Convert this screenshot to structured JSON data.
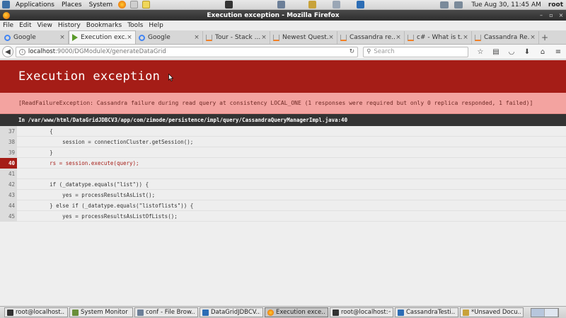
{
  "top_panel": {
    "menus": [
      "Applications",
      "Places",
      "System"
    ],
    "clock": "Tue Aug 30, 11:45 AM",
    "user": "root"
  },
  "window": {
    "title": "Execution exception - Mozilla Firefox",
    "controls": [
      "–",
      "▫",
      "×"
    ]
  },
  "menubar": [
    "File",
    "Edit",
    "View",
    "History",
    "Bookmarks",
    "Tools",
    "Help"
  ],
  "tabs": [
    {
      "label": "Google",
      "icon": "google-icon",
      "color": "#4285f4",
      "active": false
    },
    {
      "label": "Execution exc...",
      "icon": "play-icon",
      "color": "#5a9a2a",
      "active": true
    },
    {
      "label": "Google",
      "icon": "google-icon",
      "color": "#4285f4",
      "active": false
    },
    {
      "label": "Tour - Stack ...",
      "icon": "stackoverflow-icon",
      "color": "#f48024",
      "active": false
    },
    {
      "label": "Newest Quest...",
      "icon": "stackoverflow-icon",
      "color": "#f48024",
      "active": false
    },
    {
      "label": "Cassandra re...",
      "icon": "stackoverflow-icon",
      "color": "#f48024",
      "active": false
    },
    {
      "label": "c# - What is t...",
      "icon": "stackoverflow-icon",
      "color": "#f48024",
      "active": false
    },
    {
      "label": "Cassandra Re...",
      "icon": "stackoverflow-icon",
      "color": "#f48024",
      "active": false
    }
  ],
  "nav": {
    "url_host": "localhost",
    "url_path": ":9000/DGModuleX/generateDataGrid",
    "search_placeholder": "Search"
  },
  "page": {
    "title": "Execution exception",
    "message": "[ReadFailureException: Cassandra failure during read query at consistency LOCAL_ONE (1 responses were required but only 0 replica responded, 1 failed)]",
    "file": "In /var/www/html/DataGridJDBCV3/app/com/zimode/persistence/impl/query/CassandraQueryManagerImpl.java:40",
    "code": [
      {
        "line": "37",
        "text": "        {",
        "highlight": false
      },
      {
        "line": "38",
        "text": "            session = connectionCluster.getSession();",
        "highlight": false
      },
      {
        "line": "39",
        "text": "        }",
        "highlight": false
      },
      {
        "line": "40",
        "text": "        rs = session.execute(query);",
        "highlight": true
      },
      {
        "line": "41",
        "text": "",
        "highlight": false
      },
      {
        "line": "42",
        "text": "        if (_datatype.equals(\"list\")) {",
        "highlight": false
      },
      {
        "line": "43",
        "text": "            yes = processResultsAsList();",
        "highlight": false
      },
      {
        "line": "44",
        "text": "        } else if (_datatype.equals(\"listoflists\")) {",
        "highlight": false
      },
      {
        "line": "45",
        "text": "            yes = processResultsAsListOfLists();",
        "highlight": false
      }
    ]
  },
  "taskbar": [
    {
      "label": "root@localhost...",
      "icon": "terminal-icon",
      "color": "#333333",
      "active": false
    },
    {
      "label": "System Monitor",
      "icon": "monitor-icon",
      "color": "#6a8f3a",
      "active": false
    },
    {
      "label": "conf - File Brow...",
      "icon": "folder-icon",
      "color": "#6c7f98",
      "active": false
    },
    {
      "label": "DataGridJDBCV...",
      "icon": "ide-icon",
      "color": "#2c6db5",
      "active": false
    },
    {
      "label": "Execution exce...",
      "icon": "firefox-icon",
      "color": "#e66000",
      "active": true
    },
    {
      "label": "root@localhost:~",
      "icon": "terminal-icon",
      "color": "#333333",
      "active": false
    },
    {
      "label": "CassandraTesti...",
      "icon": "ide-icon",
      "color": "#2c6db5",
      "active": false
    },
    {
      "label": "*Unsaved Docu...",
      "icon": "editor-icon",
      "color": "#c8a23a",
      "active": false
    }
  ],
  "colors": {
    "error_header": "#a51d17",
    "error_message_bg": "#f3a3a0",
    "file_bar": "#333333"
  }
}
